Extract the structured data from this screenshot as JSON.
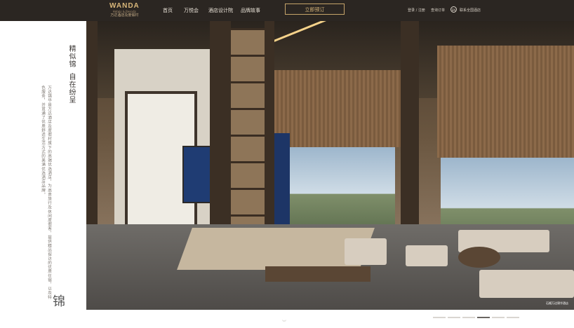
{
  "header": {
    "logo": {
      "brand": "WANDA",
      "sub": "Hotels & Resorts",
      "cn": "万达酒店及度假村"
    },
    "nav": [
      {
        "label": "首页"
      },
      {
        "label": "万悦会"
      },
      {
        "label": "酒店设计院"
      },
      {
        "label": "品牌故事"
      }
    ],
    "book_label": "立即预订",
    "login_label": "登录 / 注册",
    "orders_label": "查询订单",
    "lang_label": "EN",
    "contact_label": "联系全国酒店"
  },
  "left": {
    "title_a": "精似锦",
    "title_b": "自在纷呈",
    "body": "万达锦华是万达酒店及度假村旗下的高端优选酒店，为高贵旅行及休闲度假客，提供精品探访的优质住宿，以及特色服务，并贯通了优质舒适生活方式的美满优选酒店品牌。",
    "seal_char": "锦"
  },
  "hero": {
    "caption": "石榴万达锦华酒店"
  },
  "carousel": {
    "count": 6,
    "active_index": 3
  }
}
